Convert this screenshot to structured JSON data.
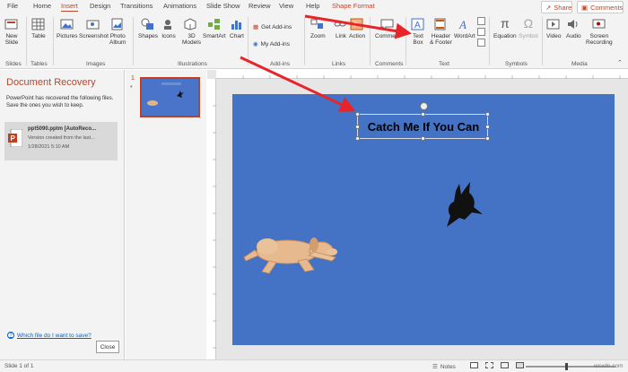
{
  "tabs": [
    {
      "label": "File"
    },
    {
      "label": "Home"
    },
    {
      "label": "Insert",
      "active": true
    },
    {
      "label": "Design"
    },
    {
      "label": "Transitions"
    },
    {
      "label": "Animations"
    },
    {
      "label": "Slide Show"
    },
    {
      "label": "Review"
    },
    {
      "label": "View"
    },
    {
      "label": "Help"
    },
    {
      "label": "Shape Format",
      "contextual": true
    }
  ],
  "top_right": {
    "share_label": "Share",
    "comments_label": "Comments"
  },
  "ribbon": {
    "new_slide": "New\nSlide",
    "table": "Table",
    "pictures": "Pictures",
    "screenshot": "Screenshot",
    "photo_album": "Photo\nAlbum",
    "shapes": "Shapes",
    "icons": "Icons",
    "models_3d": "3D\nModels",
    "smartart": "SmartArt",
    "chart": "Chart",
    "get_addins": "Get Add-ins",
    "my_addins": "My Add-ins",
    "zoom": "Zoom",
    "link": "Link",
    "action": "Action",
    "comment": "Comment",
    "text_box": "Text\nBox",
    "header_footer": "Header\n& Footer",
    "wordart": "WordArt",
    "equation": "Equation",
    "symbol": "Symbol",
    "video": "Video",
    "audio": "Audio",
    "screen_recording": "Screen\nRecording",
    "groups": {
      "slides": "Slides",
      "tables": "Tables",
      "images": "Images",
      "illustrations": "Illustrations",
      "addins": "Add-ins",
      "links": "Links",
      "comments": "Comments",
      "text": "Text",
      "symbols": "Symbols",
      "media": "Media"
    }
  },
  "recovery": {
    "title": "Document Recovery",
    "description": "PowerPoint has recovered the following files. Save the ones you wish to keep.",
    "file_name": "ppt5090.pptm [AutoReco...",
    "file_sub": "Version created from the last...",
    "file_date": "1/28/2021 5:10 AM",
    "link": "Which file do I want to save?",
    "close_label": "Close"
  },
  "thumbnails": {
    "number": "1",
    "star": "*"
  },
  "slide": {
    "title": "Catch Me If You Can"
  },
  "status": {
    "slide_info": "Slide 1 of 1",
    "notes_label": "Notes"
  },
  "watermark": "wsxdn.com",
  "colors": {
    "accent": "#b7472a",
    "slide_bg": "#4472c4",
    "arrow": "#e8242b",
    "selected_thumb_border": "#c43e1c"
  },
  "icons": {
    "share": "share-icon",
    "comments": "comment-icon",
    "text_box": "text-box-icon"
  }
}
